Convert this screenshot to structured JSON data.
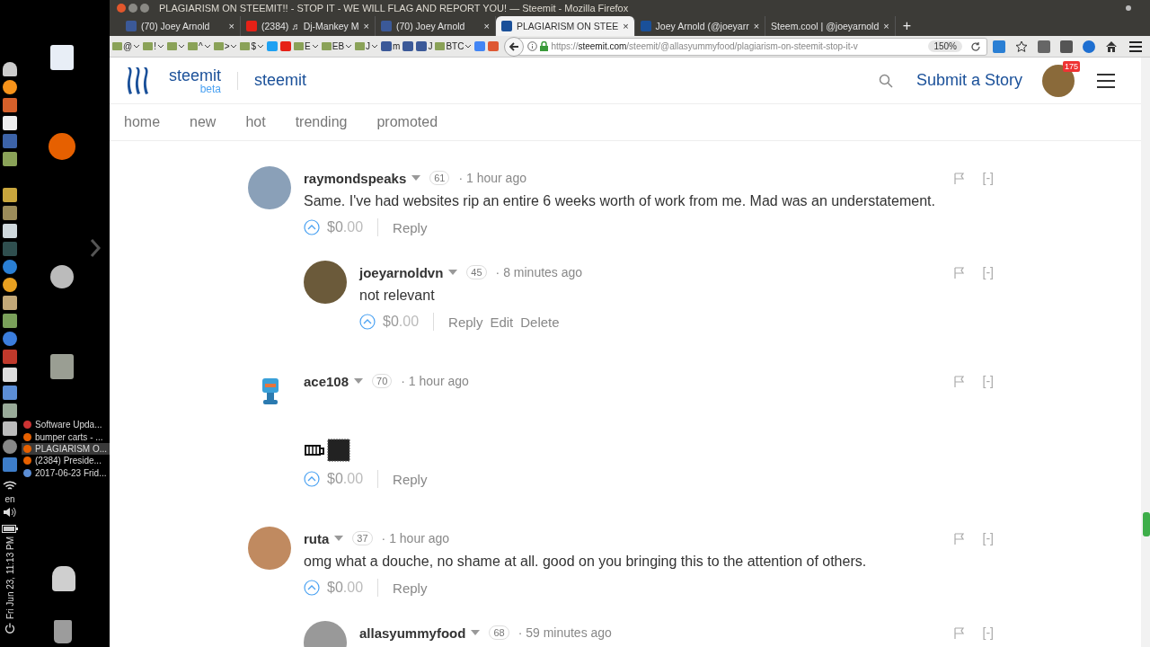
{
  "desktop": {
    "window_list": [
      {
        "label": "Software Upda...",
        "selected": false
      },
      {
        "label": "bumper carts - ...",
        "selected": false
      },
      {
        "label": "PLAGIARISM O...",
        "selected": true
      },
      {
        "label": "(2384) Preside...",
        "selected": false
      },
      {
        "label": "2017-06-23 Frid...",
        "selected": false
      }
    ],
    "keyboard_layout": "en",
    "clock": "Fri Jun 23, 11:13 PM"
  },
  "window": {
    "title": "PLAGIARISM ON STEEMIT!! - STOP IT - WE WILL FLAG AND REPORT YOU! — Steemit - Mozilla Firefox"
  },
  "tabs": [
    {
      "label": "(70) Joey Arnold",
      "selected": false,
      "close": "×"
    },
    {
      "label": "(2384) ♬ Dj-Mankey M",
      "selected": false,
      "close": "×"
    },
    {
      "label": "(70) Joey Arnold",
      "selected": false,
      "close": "×"
    },
    {
      "label": "PLAGIARISM ON STEE",
      "selected": true,
      "close": "×"
    },
    {
      "label": "Joey Arnold (@joeyarr",
      "selected": false,
      "close": "×"
    },
    {
      "label": "Steem.cool | @joeyarnold",
      "selected": false,
      "close": "×"
    }
  ],
  "new_tab": "+",
  "bookmarks": [
    {
      "kind": "folder",
      "label": "@"
    },
    {
      "kind": "folder",
      "label": "!"
    },
    {
      "kind": "folder"
    },
    {
      "kind": "folder",
      "label": "^"
    },
    {
      "kind": "folder",
      "label": ">"
    },
    {
      "kind": "folder",
      "label": "$"
    },
    {
      "kind": "site"
    },
    {
      "kind": "site"
    },
    {
      "kind": "folder",
      "label": "E"
    },
    {
      "kind": "folder",
      "label": "EB"
    },
    {
      "kind": "folder",
      "label": "J"
    },
    {
      "kind": "site",
      "label": "m"
    },
    {
      "kind": "site"
    },
    {
      "kind": "site",
      "label": "J"
    },
    {
      "kind": "folder",
      "label": "BTC"
    },
    {
      "kind": "site"
    },
    {
      "kind": "site"
    }
  ],
  "address_bar": {
    "scheme": "https://",
    "domain": "steemit.com",
    "path": "/steemit/@allasyummyfood/plagiarism-on-steemit-stop-it-v",
    "zoom": "150%"
  },
  "header": {
    "brand": "steemit",
    "brand_tag": "beta",
    "section": "steemit",
    "submit": "Submit a Story",
    "notification_count": "175"
  },
  "nav": [
    "home",
    "new",
    "hot",
    "trending",
    "promoted"
  ],
  "comments": [
    {
      "author": "raymondspeaks",
      "reputation": "61",
      "time": "· 1 hour ago",
      "kind": "text",
      "body": "Same. I've had websites rip an entire 6 weeks worth of work from me. Mad was an understatement.",
      "payout_dollars": "$0",
      "payout_cents": ".00",
      "actions": [
        "Reply"
      ],
      "collapse": "[-]",
      "children": [
        {
          "author": "joeyarnoldvn",
          "reputation": "45",
          "time": "· 8 minutes ago",
          "kind": "text",
          "body": "not relevant",
          "payout_dollars": "$0",
          "payout_cents": ".00",
          "actions": [
            "Reply",
            "Edit",
            "Delete"
          ],
          "collapse": "[-]"
        }
      ]
    },
    {
      "author": "ace108",
      "reputation": "70",
      "time": "· 1 hour ago",
      "kind": "image",
      "payout_dollars": "$0",
      "payout_cents": ".00",
      "actions": [
        "Reply"
      ],
      "collapse": "[-]"
    },
    {
      "author": "ruta",
      "reputation": "37",
      "time": "· 1 hour ago",
      "kind": "text",
      "body": "omg what a douche, no shame at all. good on you bringing this to the attention of others.",
      "payout_dollars": "$0",
      "payout_cents": ".00",
      "actions": [
        "Reply"
      ],
      "collapse": "[-]",
      "children": [
        {
          "author": "allasyummyfood",
          "reputation": "68",
          "time": "· 59 minutes ago",
          "kind": "text",
          "collapse": "[-]"
        }
      ]
    }
  ]
}
